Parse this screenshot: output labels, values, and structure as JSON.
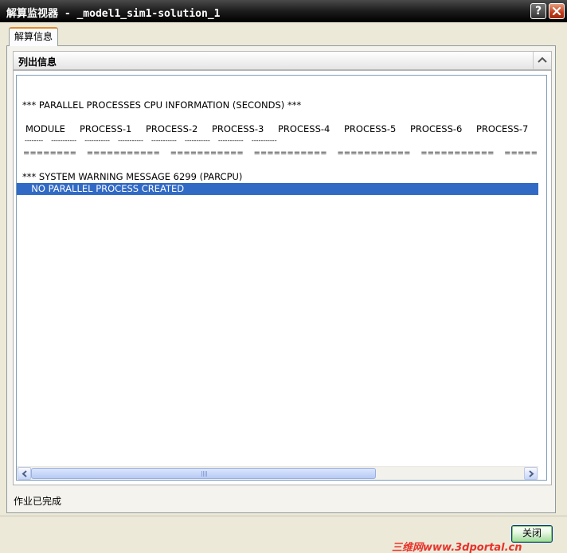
{
  "window": {
    "title": "解算监视器 - _model1_sim1-solution_1",
    "help_label": "?"
  },
  "tabs": [
    {
      "label": "解算信息",
      "active": true
    }
  ],
  "group": {
    "title": "列出信息"
  },
  "list": {
    "header_line": "*** PARALLEL PROCESSES CPU INFORMATION (SECONDS) ***",
    "columns": [
      "MODULE",
      "PROCESS-1",
      "PROCESS-2",
      "PROCESS-3",
      "PROCESS-4",
      "PROCESS-5",
      "PROCESS-6",
      "PROCESS-7"
    ],
    "dash_line": "--------    -----------    -----------    -----------    -----------    -----------    -----------    -----------",
    "equals_line": "========    ===========    ===========    ===========    ===========    ===========    ===========    ===========",
    "warning_line": "*** SYSTEM WARNING MESSAGE 6299 (PARCPU)",
    "selected_line": "     NO PARALLEL PROCESS CREATED",
    "hscroll_fraction": 0.7
  },
  "status": {
    "text": "作业已完成"
  },
  "buttons": {
    "close_label": "关闭"
  },
  "watermark": {
    "text": "三维网www.3dportal.cn"
  },
  "colors": {
    "selection": "#316ac5",
    "window_bg": "#ece9d8",
    "titlebar": "#000000"
  }
}
